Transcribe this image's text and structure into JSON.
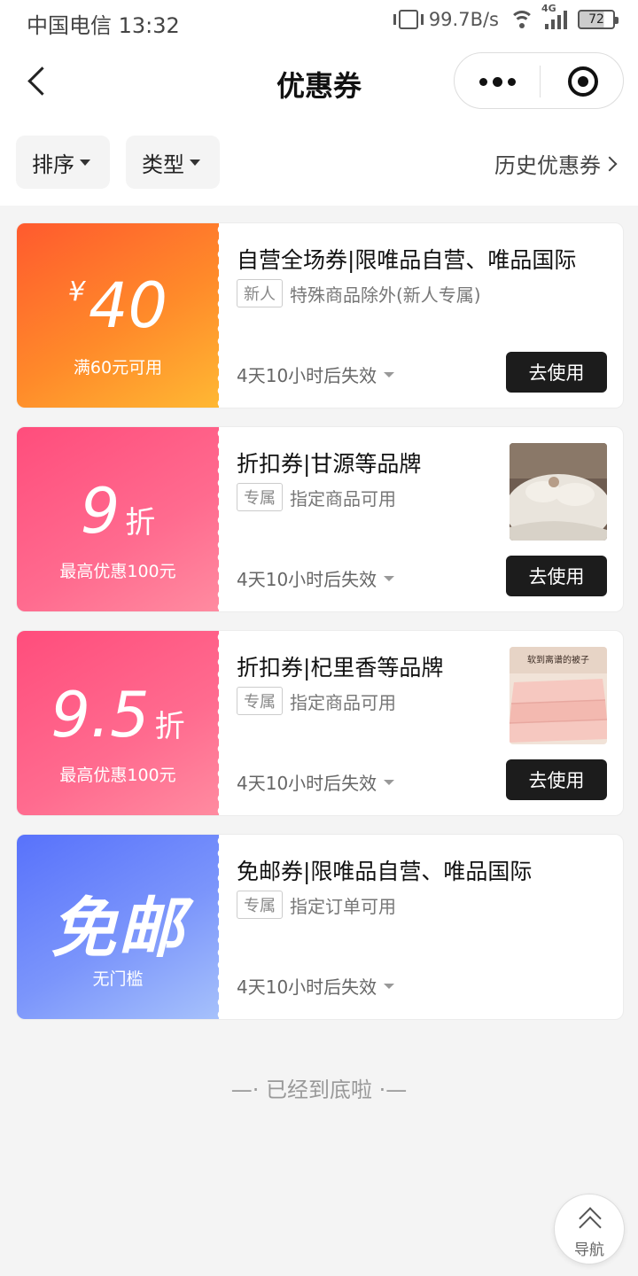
{
  "status_bar": {
    "carrier_time": "中国电信 13:32",
    "speed": "99.7B/s",
    "network": "4G",
    "battery": "72"
  },
  "header": {
    "title": "优惠券"
  },
  "filters": {
    "sort": "排序",
    "type": "类型",
    "history": "历史优惠券"
  },
  "coupons": [
    {
      "currency": "¥",
      "value": "40",
      "condition": "满60元可用",
      "name": "自营全场券|限唯品自营、唯品国际",
      "tag": "新人",
      "tag_text": "特殊商品除外(新人专属)",
      "expire": "4天10小时后失效",
      "button": "去使用"
    },
    {
      "value": "9",
      "unit": "折",
      "condition": "最高优惠100元",
      "name": "折扣券|甘源等品牌",
      "tag": "专属",
      "tag_text": "指定商品可用",
      "expire": "4天10小时后失效",
      "button": "去使用"
    },
    {
      "value": "9.5",
      "unit": "折",
      "condition": "最高优惠100元",
      "name": "折扣券|杞里香等品牌",
      "tag": "专属",
      "tag_text": "指定商品可用",
      "expire": "4天10小时后失效",
      "button": "去使用",
      "image_caption": "软到离谱的被子"
    },
    {
      "value": "免邮",
      "condition": "无门槛",
      "name": "免邮券|限唯品自营、唯品国际",
      "tag": "专属",
      "tag_text": "指定订单可用",
      "expire": "4天10小时后失效"
    }
  ],
  "footer": {
    "end_text": "—· 已经到底啦 ·—",
    "nav_label": "导航"
  },
  "colors": {
    "coupon_orange": "#ff7a2c",
    "coupon_pink": "#ff5a85",
    "coupon_blue": "#6a84fb",
    "button_dark": "#1c1c1c"
  }
}
